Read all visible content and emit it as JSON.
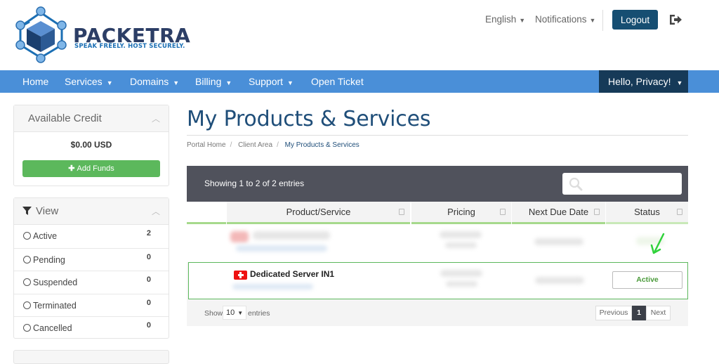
{
  "brand": {
    "name": "PACKETRA",
    "tagline": "SPEAK FREELY. HOST SECURELY."
  },
  "header": {
    "language": "English",
    "notifications": "Notifications",
    "logout": "Logout"
  },
  "nav": {
    "items": [
      "Home",
      "Services",
      "Domains",
      "Billing",
      "Support",
      "Open Ticket"
    ],
    "greeting": "Hello, Privacy!"
  },
  "sidebar": {
    "credit": {
      "title": "Available Credit",
      "amount": "$0.00 USD",
      "add_funds": "Add Funds"
    },
    "view": {
      "title": "View",
      "items": [
        {
          "label": "Active",
          "count": "2"
        },
        {
          "label": "Pending",
          "count": "0"
        },
        {
          "label": "Suspended",
          "count": "0"
        },
        {
          "label": "Terminated",
          "count": "0"
        },
        {
          "label": "Cancelled",
          "count": "0"
        }
      ]
    }
  },
  "main": {
    "title": "My Products & Services",
    "breadcrumb": [
      "Portal Home",
      "Client Area",
      "My Products & Services"
    ],
    "table": {
      "showing": "Showing 1 to 2 of 2 entries",
      "columns": [
        "Product/Service",
        "Pricing",
        "Next Due Date",
        "Status"
      ],
      "rows": [
        {
          "product": "",
          "status": ""
        },
        {
          "product": "Dedicated Server IN1",
          "status": "Active"
        }
      ],
      "footer": {
        "show": "Show",
        "page_size": "10",
        "entries": "entries"
      },
      "pagination": {
        "previous": "Previous",
        "current": "1",
        "next": "Next"
      }
    }
  },
  "colors": {
    "nav": "#4a8fd8",
    "nav_dark": "#163a58",
    "title": "#1f4e79",
    "green": "#5cb85c",
    "table_header": "#50525c"
  },
  "icons": [
    "logo-cube",
    "exit-icon",
    "filter-icon",
    "search-icon",
    "swiss-flag-icon",
    "arrow-icon"
  ]
}
